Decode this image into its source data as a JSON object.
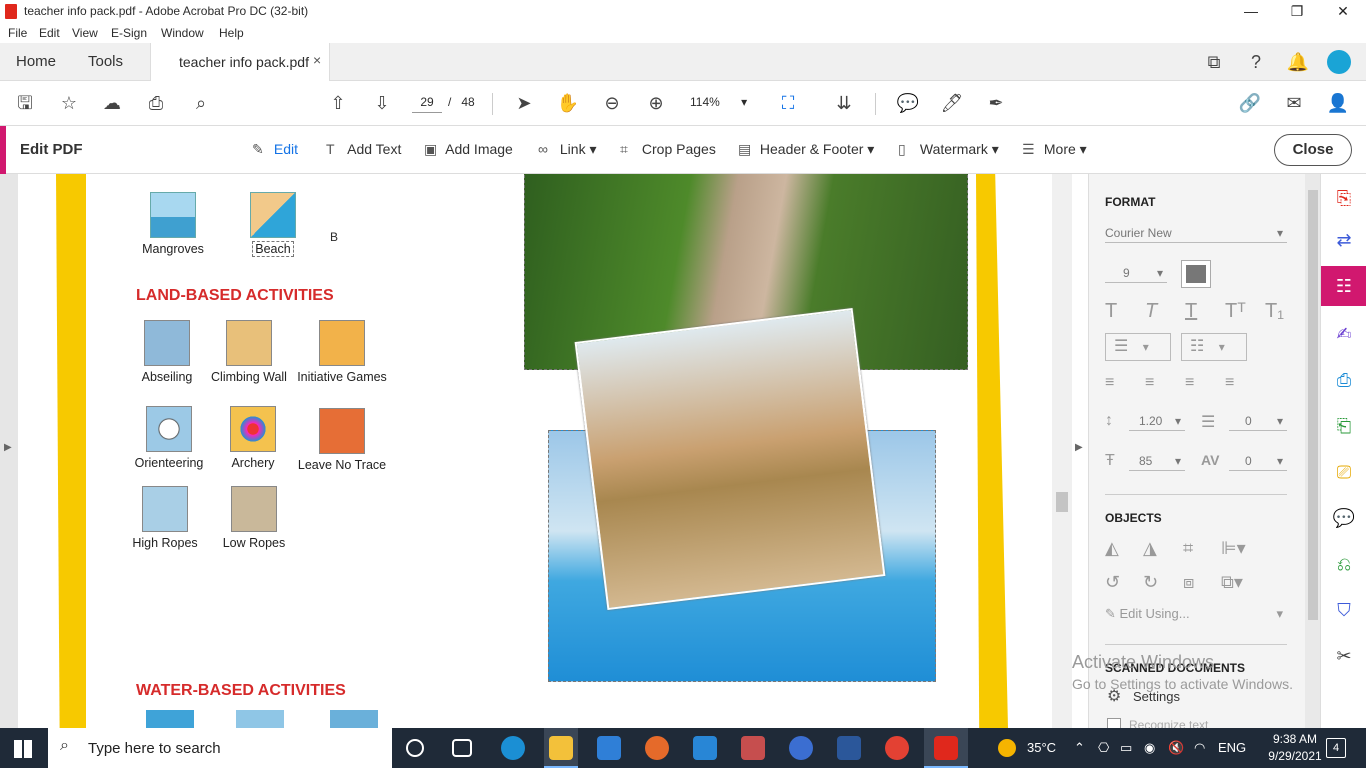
{
  "window": {
    "title": "teacher info pack.pdf - Adobe Acrobat Pro DC (32-bit)",
    "minimize": "—",
    "restore": "❐",
    "close": "✕"
  },
  "menu": [
    "File",
    "Edit",
    "View",
    "E-Sign",
    "Window",
    "Help"
  ],
  "tabs": {
    "home": "Home",
    "tools": "Tools",
    "document": "teacher info pack.pdf",
    "close": "×"
  },
  "toolbar": {
    "page_current": "29",
    "page_separator": "/",
    "page_total": "48",
    "zoom": "114%"
  },
  "editbar": {
    "title": "Edit PDF",
    "tools": [
      {
        "label": "Edit",
        "icon": "✎"
      },
      {
        "label": "Add Text",
        "icon": "T"
      },
      {
        "label": "Add Image",
        "icon": "▣"
      },
      {
        "label": "Link ▾",
        "icon": "∞"
      },
      {
        "label": "Crop Pages",
        "icon": "⌗"
      },
      {
        "label": "Header & Footer ▾",
        "icon": "▤"
      },
      {
        "label": "Watermark ▾",
        "icon": "▯"
      },
      {
        "label": "More ▾",
        "icon": "☰"
      }
    ],
    "close": "Close"
  },
  "document": {
    "beach_row": {
      "mangroves": "Mangroves",
      "beach": "Beach",
      "extra": "B"
    },
    "land_heading": "LAND-BASED ACTIVITIES",
    "activities": [
      {
        "label": "Abseiling"
      },
      {
        "label": "Climbing Wall"
      },
      {
        "label": "Initiative Games"
      },
      {
        "label": "Orienteering"
      },
      {
        "label": "Archery"
      },
      {
        "label": "Leave No Trace"
      },
      {
        "label": "High Ropes"
      },
      {
        "label": "Low Ropes"
      }
    ],
    "water_heading": "WATER-BASED ACTIVITIES"
  },
  "format_panel": {
    "format_heading": "FORMAT",
    "font": "Courier New",
    "font_size": "9",
    "line_spacing": "1.20",
    "para_spacing": "0",
    "scale": "85",
    "char_spacing": "0",
    "objects_heading": "OBJECTS",
    "edit_using": "Edit Using...",
    "scanned_heading": "SCANNED DOCUMENTS",
    "settings": "Settings",
    "recognize": "Recognize text"
  },
  "activate": {
    "line1": "Activate Windows",
    "line2": "Go to Settings to activate Windows."
  },
  "taskbar": {
    "search_placeholder": "Type here to search",
    "temperature": "35°C",
    "language": "ENG",
    "time": "9:38 AM",
    "date": "9/29/2021",
    "notifications": "4"
  },
  "colors": {
    "accent": "#d1186f",
    "active_tool": "#1473e6",
    "section_heading": "#d62b2b",
    "page_stripe": "#f7c900"
  }
}
